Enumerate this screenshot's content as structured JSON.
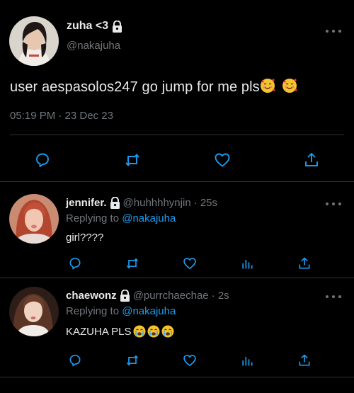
{
  "main_tweet": {
    "display_name": "zuha <3",
    "handle": "@nakajuha",
    "text": "user aespasolos247 go jump for me pls",
    "emojis": [
      "smiling-face-with-hearts",
      "smiling-face-with-hearts"
    ],
    "timestamp": "05:19 PM · 23 Dec 23"
  },
  "replies": [
    {
      "display_name": "jennifer.",
      "handle": "@huhhhhynjin",
      "time_ago": "· 25s",
      "replying_prefix": "Replying to",
      "replying_to": "@nakajuha",
      "text": "girl????",
      "emojis": []
    },
    {
      "display_name": "chaewonz",
      "handle": "@purrchaechae",
      "time_ago": "· 2s",
      "replying_prefix": "Replying to",
      "replying_to": "@nakajuha",
      "text": "KAZUHA PLS",
      "emojis": [
        "loudly-crying-face",
        "loudly-crying-face",
        "loudly-crying-face"
      ]
    }
  ],
  "colors": {
    "background": "#000000",
    "text": "#e7e9ea",
    "muted": "#71767b",
    "link": "#1d9bf0",
    "divider": "#2f3336"
  }
}
